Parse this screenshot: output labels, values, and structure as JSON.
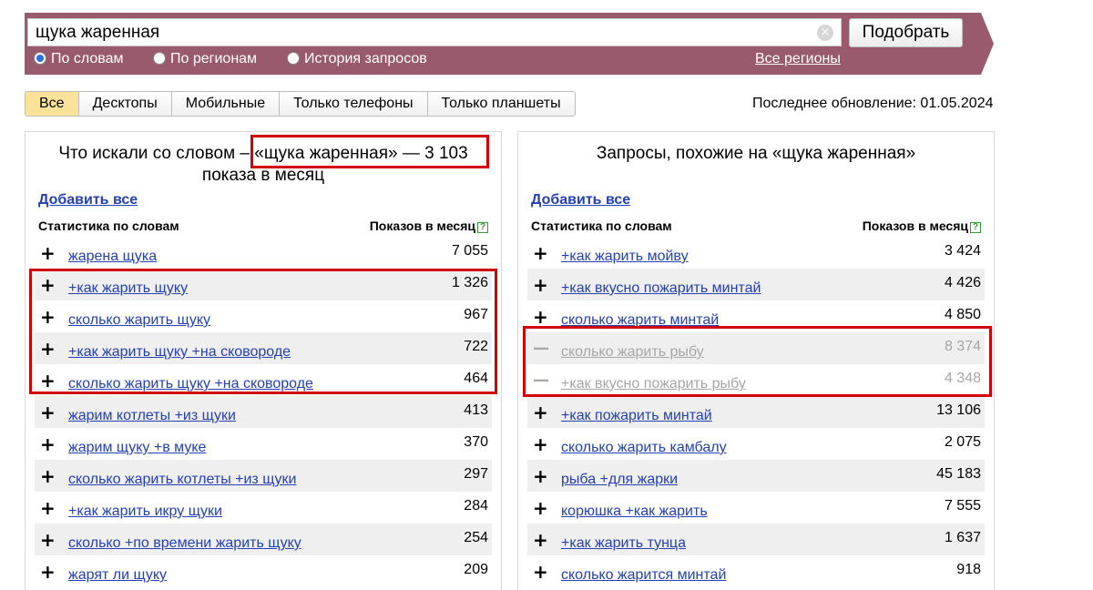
{
  "search": {
    "query": "щука жаренная",
    "clear_icon": "clear-icon",
    "button_label": "Подобрать"
  },
  "modes": [
    {
      "label": "По словам",
      "selected": true
    },
    {
      "label": "По регионам",
      "selected": false
    },
    {
      "label": "История запросов",
      "selected": false
    }
  ],
  "regions_link": "Все регионы",
  "tabs": [
    "Все",
    "Десктопы",
    "Мобильные",
    "Только телефоны",
    "Только планшеты"
  ],
  "active_tab": "Все",
  "last_update": "Последнее обновление: 01.05.2024",
  "left_panel": {
    "title_prefix": "Что искали со словом  –",
    "title_highlight": "«щука жаренная» — 3 103",
    "title_suffix": "показа в месяц",
    "add_all": "Добавить все",
    "col_words": "Статистика по словам",
    "col_shows": "Показов в месяц",
    "rows": [
      {
        "sign": "+",
        "keyword": "жарена щука",
        "count": "7 055"
      },
      {
        "sign": "+",
        "keyword": "+как жарить щуку",
        "count": "1 326"
      },
      {
        "sign": "+",
        "keyword": "сколько жарить щуку",
        "count": "967"
      },
      {
        "sign": "+",
        "keyword": "+как жарить щуку +на сковороде",
        "count": "722"
      },
      {
        "sign": "+",
        "keyword": "сколько жарить щуку +на сковороде",
        "count": "464"
      },
      {
        "sign": "+",
        "keyword": "жарим котлеты +из щуки",
        "count": "413"
      },
      {
        "sign": "+",
        "keyword": "жарим щуку +в муке",
        "count": "370"
      },
      {
        "sign": "+",
        "keyword": "сколько жарить котлеты +из щуки",
        "count": "297"
      },
      {
        "sign": "+",
        "keyword": "+как жарить икру щуки",
        "count": "284"
      },
      {
        "sign": "+",
        "keyword": "сколько +по времени жарить щуку",
        "count": "254"
      },
      {
        "sign": "+",
        "keyword": "жарят ли щуку",
        "count": "209"
      }
    ]
  },
  "right_panel": {
    "title": "Запросы, похожие на «щука жаренная»",
    "add_all": "Добавить все",
    "col_words": "Статистика по словам",
    "col_shows": "Показов в месяц",
    "rows": [
      {
        "sign": "+",
        "keyword": "+как жарить мойву",
        "count": "3 424",
        "excluded": false
      },
      {
        "sign": "+",
        "keyword": "+как вкусно пожарить минтай",
        "count": "4 426",
        "excluded": false
      },
      {
        "sign": "+",
        "keyword": "сколько жарить минтай",
        "count": "4 850",
        "excluded": false
      },
      {
        "sign": "—",
        "keyword": "сколько жарить рыбу",
        "count": "8 374",
        "excluded": true
      },
      {
        "sign": "—",
        "keyword": "+как вкусно пожарить рыбу",
        "count": "4 348",
        "excluded": true
      },
      {
        "sign": "+",
        "keyword": "+как пожарить минтай",
        "count": "13 106",
        "excluded": false
      },
      {
        "sign": "+",
        "keyword": "сколько жарить камбалу",
        "count": "2 075",
        "excluded": false
      },
      {
        "sign": "+",
        "keyword": "рыба +для жарки",
        "count": "45 183",
        "excluded": false
      },
      {
        "sign": "+",
        "keyword": "корюшка +как жарить",
        "count": "7 555",
        "excluded": false
      },
      {
        "sign": "+",
        "keyword": "+как жарить тунца",
        "count": "1 637",
        "excluded": false
      },
      {
        "sign": "+",
        "keyword": "сколько жарится минтай",
        "count": "918",
        "excluded": false
      }
    ]
  },
  "highlight_color": "#d10000"
}
